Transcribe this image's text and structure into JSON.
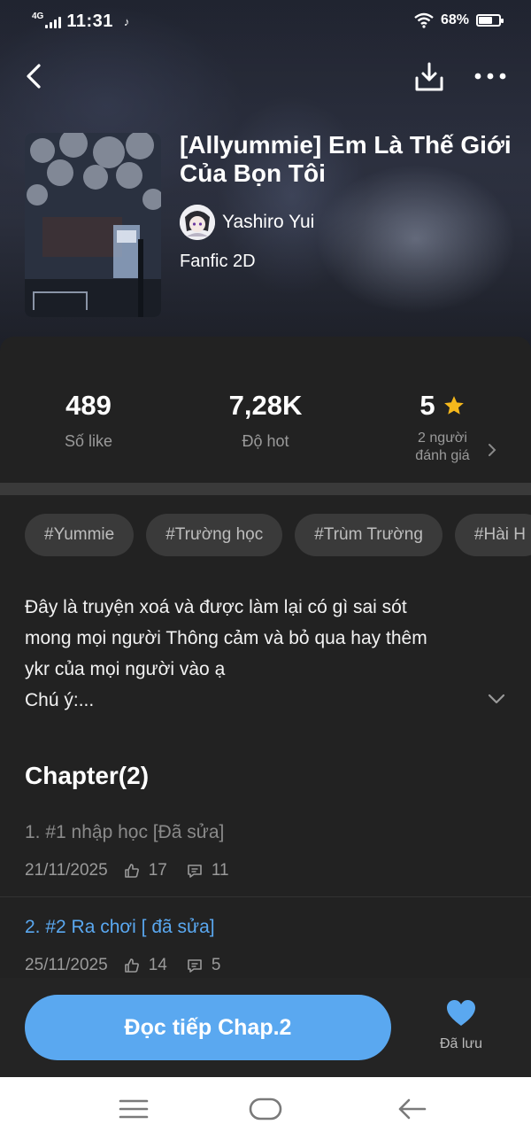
{
  "status_bar": {
    "network": "4G",
    "time": "11:31",
    "battery_percent": "68%",
    "battery_level": 0.68
  },
  "top_bar": {
    "icons": [
      "back-icon",
      "download-icon",
      "more-icon"
    ]
  },
  "book": {
    "title": "[Allyummie] Em Là Thế Giới Của Bọn Tôi",
    "author": "Yashiro Yui",
    "genre": "Fanfic 2D"
  },
  "stats": {
    "likes_value": "489",
    "likes_label": "Số like",
    "hot_value": "7,28K",
    "hot_label": "Độ hot",
    "rating_value": "5",
    "rating_label_1": "2 người",
    "rating_label_2": "đánh giá"
  },
  "tags": [
    "#Yummie",
    "#Trường học",
    "#Trùm Trường",
    "#Hài H"
  ],
  "description": {
    "line1": "Đây là truyện xoá và được làm lại có gì sai sót",
    "line2": "mong mọi người Thông cảm và bỏ qua hay thêm",
    "line3": "ykr của mọi người vào ạ",
    "line4": "Chú ý:..."
  },
  "chapters": {
    "header": "Chapter(2)",
    "items": [
      {
        "title": "1. #1 nhập học [Đã sửa]",
        "date": "21/11/2025",
        "likes": "17",
        "comments": "11",
        "title_color": "#8a8a8a"
      },
      {
        "title": "2. #2 Ra chơi [ đã sửa]",
        "date": "25/11/2025",
        "likes": "14",
        "comments": "5",
        "title_color": "#5aa8f0"
      }
    ]
  },
  "actions": {
    "read_label": "Đọc tiếp Chap.2",
    "saved_label": "Đã lưu",
    "accent": "#5aa8f0"
  }
}
